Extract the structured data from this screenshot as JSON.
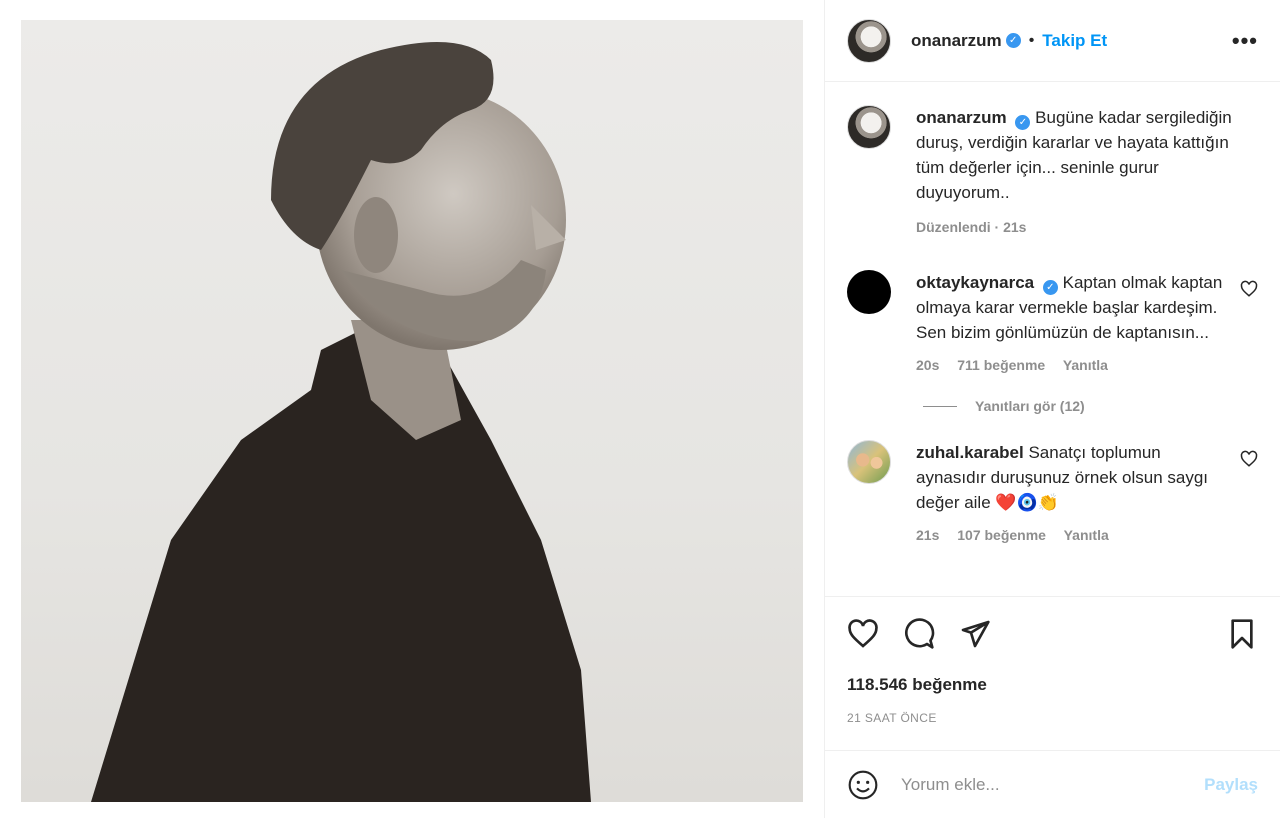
{
  "post": {
    "username": "onanarzum",
    "verified_mark": "✓",
    "follow_label": "Takip Et",
    "more_label": "•••"
  },
  "caption": {
    "username": "onanarzum",
    "text": "Bugüne kadar sergilediğin duruş, verdiğin kararlar ve hayata kattığın tüm değerler için... seninle gurur duyuyorum..",
    "meta": "Düzenlendi · 21s"
  },
  "comments": [
    {
      "username": "oktaykaynarca",
      "text": "Kaptan olmak kaptan olmaya karar vermekle başlar kardeşim. Sen bizim gönlümüzün de kaptanısın...",
      "time": "20s",
      "likes": "711 beğenme",
      "reply": "Yanıtla",
      "view_replies": "Yanıtları gör (12)"
    },
    {
      "username": "zuhal.karabel",
      "text": "Sanatçı toplumun aynasıdır duruşunuz örnek olsun saygı değer aile ❤️🧿👏",
      "time": "21s",
      "likes": "107 beğenme",
      "reply": "Yanıtla"
    }
  ],
  "actions": {
    "likes": "118.546 beğenme",
    "date": "21 SAAT ÖNCE"
  },
  "composer": {
    "placeholder": "Yorum ekle...",
    "share": "Paylaş"
  },
  "icons": {
    "like": "heart-icon",
    "comment": "comment-icon",
    "share": "send-icon",
    "save": "bookmark-icon",
    "emoji": "smiley-icon"
  },
  "colors": {
    "accent": "#0095f6",
    "muted": "#8e8e8e",
    "share_disabled": "#b2dffc"
  }
}
